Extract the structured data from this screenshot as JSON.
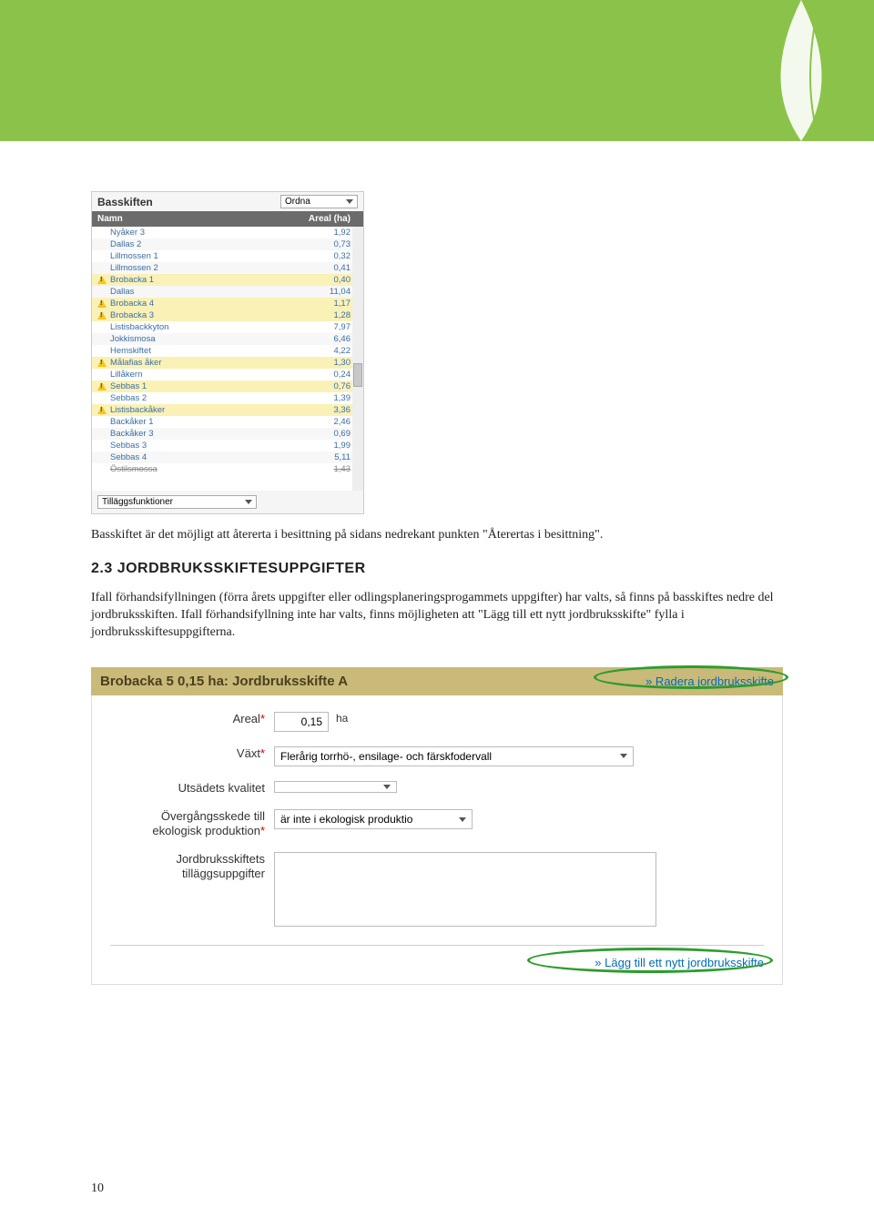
{
  "panel": {
    "title": "Basskiften",
    "sort_label": "Ordna",
    "name_header": "Namn",
    "area_header": "Areal (ha)",
    "rows": [
      {
        "name": "Nyåker 3",
        "area": "1,92",
        "warn": false,
        "strike": false
      },
      {
        "name": "Dallas 2",
        "area": "0,73",
        "warn": false,
        "strike": false
      },
      {
        "name": "Lillmossen 1",
        "area": "0,32",
        "warn": false,
        "strike": false
      },
      {
        "name": "Lillmossen 2",
        "area": "0,41",
        "warn": false,
        "strike": false
      },
      {
        "name": "Brobacka 1",
        "area": "0,40",
        "warn": true,
        "strike": false
      },
      {
        "name": "Dallas",
        "area": "11,04",
        "warn": false,
        "strike": false
      },
      {
        "name": "Brobacka 4",
        "area": "1,17",
        "warn": true,
        "strike": false
      },
      {
        "name": "Brobacka 3",
        "area": "1,28",
        "warn": true,
        "strike": false
      },
      {
        "name": "Listisbackkyton",
        "area": "7,97",
        "warn": false,
        "strike": false
      },
      {
        "name": "Jokkismosa",
        "area": "6,46",
        "warn": false,
        "strike": false
      },
      {
        "name": "Hemskiftet",
        "area": "4,22",
        "warn": false,
        "strike": false
      },
      {
        "name": "Målafias åker",
        "area": "1,30",
        "warn": true,
        "strike": false
      },
      {
        "name": "Lillåkern",
        "area": "0,24",
        "warn": false,
        "strike": false
      },
      {
        "name": "Sebbas 1",
        "area": "0,76",
        "warn": true,
        "strike": false
      },
      {
        "name": "Sebbas 2",
        "area": "1,39",
        "warn": false,
        "strike": false
      },
      {
        "name": "Listisbackåker",
        "area": "3,36",
        "warn": true,
        "strike": false
      },
      {
        "name": "Backåker 1",
        "area": "2,46",
        "warn": false,
        "strike": false
      },
      {
        "name": "Backåker 3",
        "area": "0,69",
        "warn": false,
        "strike": false
      },
      {
        "name": "Sebbas 3",
        "area": "1,99",
        "warn": false,
        "strike": false
      },
      {
        "name": "Sebbas 4",
        "area": "5,11",
        "warn": false,
        "strike": false
      },
      {
        "name": "Östilsmossa",
        "area": "1,43",
        "warn": false,
        "strike": true
      }
    ],
    "footer_label": "Tilläggsfunktioner"
  },
  "paragraph1": "Basskiftet är det möjligt att återerta i besittning på sidans nedrekant punkten \"Återertas i besittning\".",
  "heading": "2.3 JORDBRUKSSKIFTESUPPGIFTER",
  "paragraph2": "Ifall förhandsifyllningen (förra årets uppgifter eller odlingsplaneringsprogammets uppgifter) har valts, så finns på basskiftes nedre del jordbruksskiften. Ifall förhandsifyllning inte har valts, finns möjligheten att \"Lägg till ett nytt jordbruksskifte\" fylla i jordbruksskiftesuppgifterna.",
  "form": {
    "header_title": "Brobacka 5 0,15 ha: Jordbruksskifte A",
    "delete_link": "» Radera jordbruksskifte",
    "areal_label": "Areal",
    "areal_value": "0,15",
    "areal_unit": "ha",
    "vaxt_label": "Växt",
    "vaxt_value": "Flerårig torrhö-, ensilage- och färskfodervall",
    "utsade_label": "Utsädets kvalitet",
    "utsade_value": "",
    "overgang_label": "Övergångsskede till ekologisk produktion",
    "overgang_value": "är inte i ekologisk produktio",
    "tillagg_label": "Jordbruksskiftets tilläggsuppgifter",
    "add_link": "» Lägg till ett nytt jordbruksskifte"
  },
  "page_number": "10"
}
